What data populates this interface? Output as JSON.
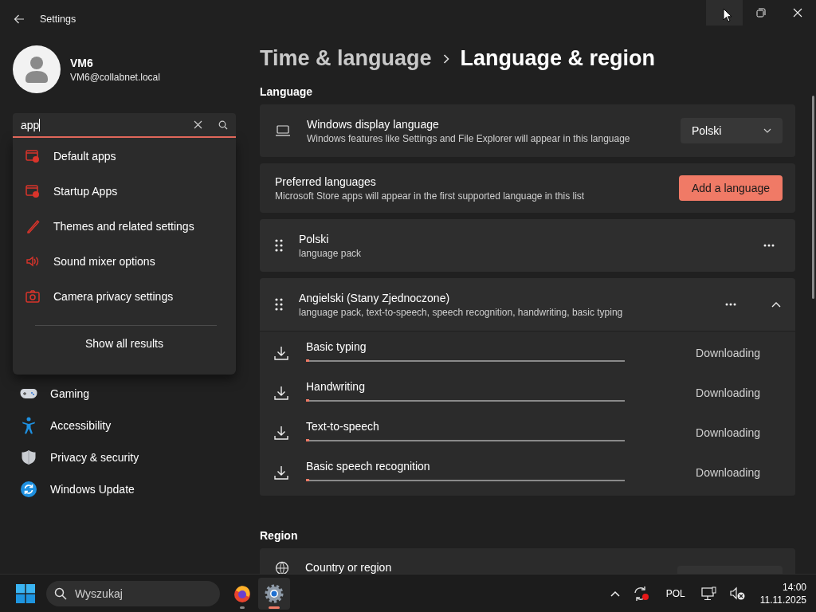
{
  "window": {
    "title": "Settings"
  },
  "user": {
    "name": "VM6",
    "email": "VM6@collabnet.local"
  },
  "search": {
    "value": "app"
  },
  "search_results": [
    {
      "label": "Default apps"
    },
    {
      "label": "Startup Apps"
    },
    {
      "label": "Themes and related settings"
    },
    {
      "label": "Sound mixer options"
    },
    {
      "label": "Camera privacy settings"
    }
  ],
  "show_all": "Show all results",
  "nav": [
    {
      "label": "Gaming"
    },
    {
      "label": "Accessibility"
    },
    {
      "label": "Privacy & security"
    },
    {
      "label": "Windows Update"
    }
  ],
  "breadcrumb": {
    "parent": "Time & language",
    "current": "Language & region"
  },
  "language": {
    "heading": "Language",
    "display_language": {
      "title": "Windows display language",
      "description": "Windows features like Settings and File Explorer will appear in this language",
      "value": "Polski"
    },
    "preferred": {
      "title": "Preferred languages",
      "description": "Microsoft Store apps will appear in the first supported language in this list",
      "button": "Add a language"
    },
    "languages": [
      {
        "name": "Polski",
        "features": "language pack"
      },
      {
        "name": "Angielski (Stany Zjednoczone)",
        "features": "language pack, text-to-speech, speech recognition, handwriting, basic typing",
        "expanded": true,
        "downloads": [
          {
            "name": "Basic typing",
            "status": "Downloading",
            "level": 0.01
          },
          {
            "name": "Handwriting",
            "status": "Downloading",
            "level": 0.01
          },
          {
            "name": "Text-to-speech",
            "status": "Downloading",
            "level": 0.01
          },
          {
            "name": "Basic speech recognition",
            "status": "Downloading",
            "level": 0.01
          }
        ]
      }
    ]
  },
  "region": {
    "heading": "Region",
    "country": {
      "title": "Country or region"
    }
  },
  "taskbar": {
    "search_placeholder": "Wyszukaj",
    "apps": [
      {
        "selected": false
      },
      {
        "selected": true
      }
    ],
    "language": "POL",
    "time": "14:00",
    "date": "11.11.2025"
  }
}
